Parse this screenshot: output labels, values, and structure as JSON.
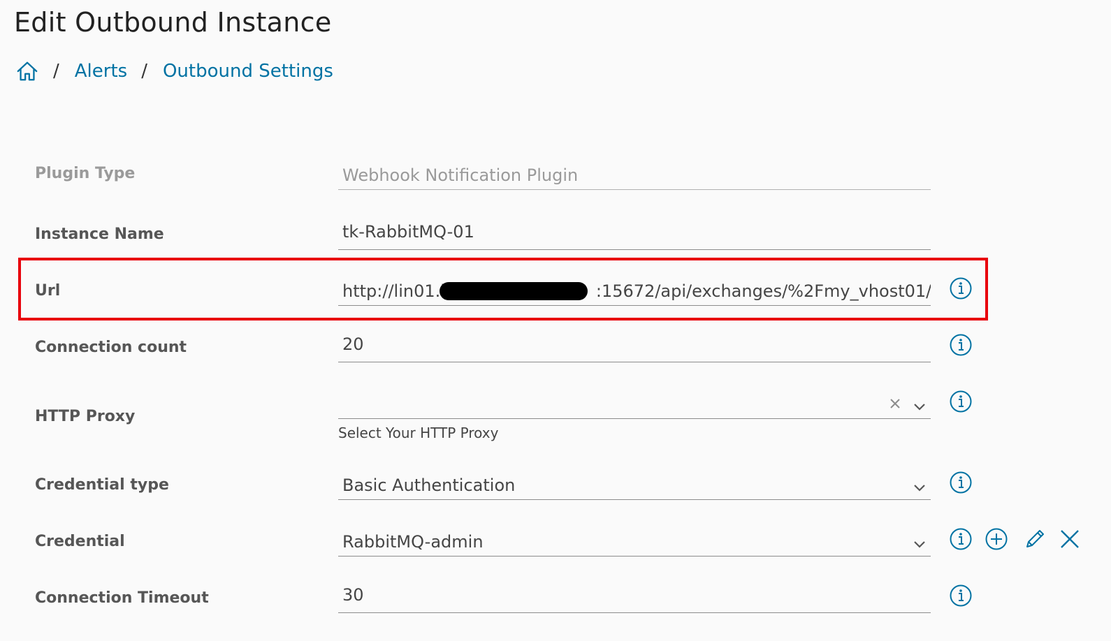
{
  "header": {
    "title": "Edit Outbound Instance"
  },
  "breadcrumb": {
    "separator": "/",
    "items": [
      "Alerts",
      "Outbound Settings"
    ]
  },
  "form": {
    "plugin_type": {
      "label": "Plugin Type",
      "value": "Webhook Notification Plugin"
    },
    "instance_name": {
      "label": "Instance Name",
      "value": "tk-RabbitMQ-01"
    },
    "url": {
      "label": "Url",
      "value_prefix": "http://lin01.i",
      "value_suffix": ":15672/api/exchanges/%2Fmy_vhost01/"
    },
    "connection_count": {
      "label": "Connection count",
      "value": "20"
    },
    "http_proxy": {
      "label": "HTTP Proxy",
      "value": "",
      "helper": "Select Your HTTP Proxy"
    },
    "credential_type": {
      "label": "Credential type",
      "value": "Basic Authentication"
    },
    "credential": {
      "label": "Credential",
      "value": "RabbitMQ-admin"
    },
    "connection_timeout": {
      "label": "Connection Timeout",
      "value": "30"
    }
  },
  "colors": {
    "link": "#0072a3",
    "highlight_border": "#e8000b",
    "background": "#fafafa"
  },
  "icons": [
    "home-icon",
    "info-icon",
    "chevron-down-icon",
    "clear-icon",
    "add-icon",
    "edit-pencil-icon",
    "close-icon"
  ]
}
